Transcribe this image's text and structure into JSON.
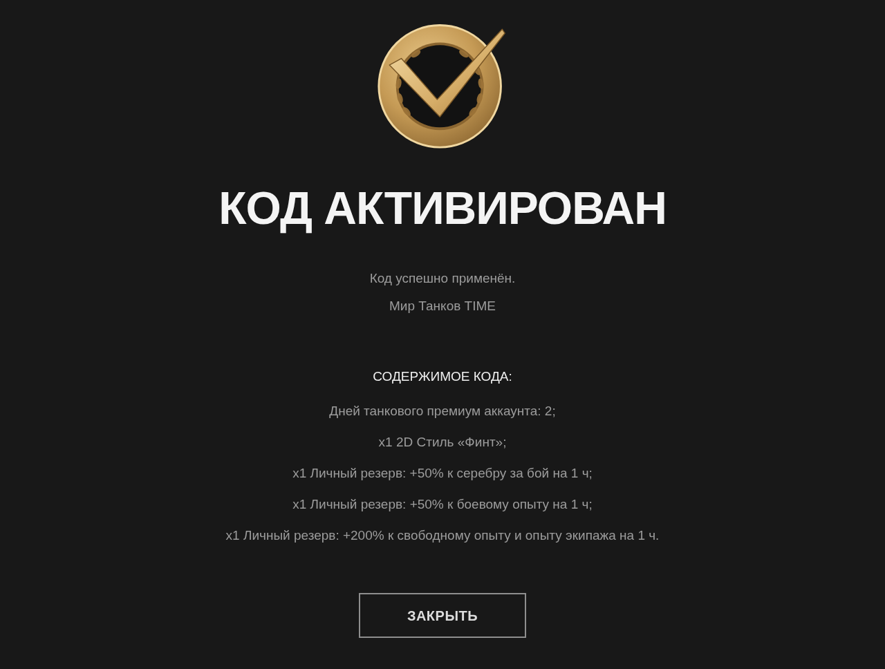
{
  "title": "КОД АКТИВИРОВАН",
  "messages": [
    "Код успешно применён.",
    "Мир Танков TIME"
  ],
  "contents": {
    "heading": "СОДЕРЖИМОЕ КОДА:",
    "items": [
      "Дней танкового премиум аккаунта: 2;",
      "x1 2D Стиль «Финт»;",
      "x1 Личный резерв: +50% к серебру за бой на 1 ч;",
      "x1 Личный резерв: +50% к боевому опыту на 1 ч;",
      "x1 Личный резерв: +200% к свободному опыту и опыту экипажа на 1 ч."
    ]
  },
  "buttons": [
    {
      "label": "ЗАКРЫТЬ"
    }
  ]
}
